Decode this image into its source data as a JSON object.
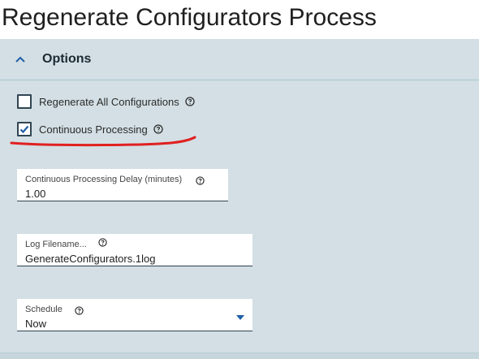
{
  "page": {
    "title": "Regenerate Configurators Process"
  },
  "options": {
    "title": "Options",
    "checkboxes": [
      {
        "label": "Regenerate All Configurations",
        "checked": false
      },
      {
        "label": "Continuous Processing",
        "checked": true
      }
    ],
    "fields": {
      "delay": {
        "label": "Continuous Processing Delay (minutes)",
        "value": "1.00"
      },
      "log": {
        "label": "Log Filename...",
        "value": "GenerateConfigurators.1log"
      },
      "schedule": {
        "label": "Schedule",
        "value": "Now"
      }
    }
  },
  "colors": {
    "panel": "#d3dfe4",
    "accent": "#1f5fa8",
    "annotation": "#e02020"
  },
  "icons": {
    "collapse": "chevron-up-icon",
    "help": "question-circle-icon",
    "checkmark": "checkmark-icon",
    "dropdown": "caret-down-icon"
  }
}
